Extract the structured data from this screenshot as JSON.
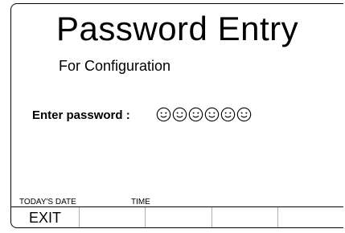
{
  "screen": {
    "title": "Password Entry",
    "subtitle": "For Configuration"
  },
  "password": {
    "label": "Enter password :",
    "mask_icon": "smiley-face-icon",
    "mask_count": 6
  },
  "status": {
    "date_label": "TODAY'S DATE",
    "time_label": "TIME"
  },
  "softkeys": [
    {
      "label": "EXIT"
    },
    {
      "label": ""
    },
    {
      "label": ""
    },
    {
      "label": ""
    },
    {
      "label": ""
    }
  ],
  "colors": {
    "text": "#000000",
    "background": "#ffffff",
    "divider": "#b0b0b0"
  }
}
